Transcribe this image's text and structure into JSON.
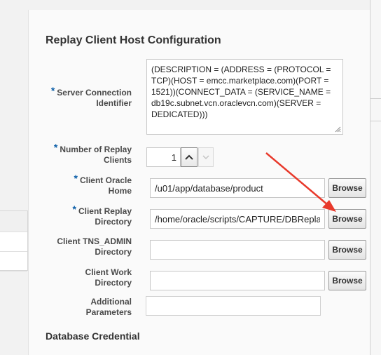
{
  "title": "Replay Client Host Configuration",
  "section2_title": "Database Credential",
  "required_marker": "*",
  "fields": {
    "server_connection": {
      "label_line1": "Server Connection",
      "label_line2": "Identifier",
      "value": "(DESCRIPTION = (ADDRESS = (PROTOCOL = TCP)(HOST = emcc.marketplace.com)(PORT = 1521))(CONNECT_DATA = (SERVICE_NAME = db19c.subnet.vcn.oraclevcn.com)(SERVER = DEDICATED)))"
    },
    "num_clients": {
      "label_line1": "Number of Replay",
      "label_line2": "Clients",
      "value": "1"
    },
    "oracle_home": {
      "label_line1": "Client Oracle",
      "label_line2": "Home",
      "value": "/u01/app/database/product",
      "button": "Browse"
    },
    "replay_dir": {
      "label_line1": "Client Replay",
      "label_line2": "Directory",
      "value": "/home/oracle/scripts/CAPTURE/DBReplayW",
      "button": "Browse"
    },
    "tns_admin": {
      "label_line1": "Client TNS_ADMIN",
      "label_line2": "Directory",
      "value": "",
      "button": "Browse"
    },
    "work_dir": {
      "label_line1": "Client Work",
      "label_line2": "Directory",
      "value": "",
      "button": "Browse"
    },
    "additional": {
      "label_line1": "Additional",
      "label_line2": "Parameters",
      "value": ""
    }
  },
  "colors": {
    "required": "#0b5ea8",
    "annotation_arrow": "#e8392b"
  },
  "icons": {
    "increment": "chevron-up-icon",
    "decrement": "chevron-down-icon",
    "resize": "resize-grip-icon"
  }
}
